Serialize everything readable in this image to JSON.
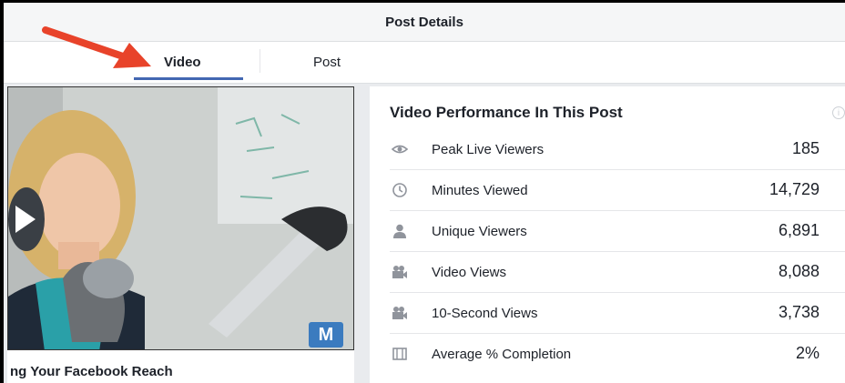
{
  "header": {
    "title": "Post Details"
  },
  "tabs": [
    {
      "label": "Video",
      "active": true
    },
    {
      "label": "Post",
      "active": false
    }
  ],
  "video": {
    "title": "ng Your Facebook Reach",
    "badge": "M",
    "play_icon": "play-icon"
  },
  "performance": {
    "title": "Video Performance In This Post",
    "metrics": [
      {
        "label": "Peak Live Viewers",
        "value": "185",
        "icon": "eye-icon"
      },
      {
        "label": "Minutes Viewed",
        "value": "14,729",
        "icon": "clock-icon"
      },
      {
        "label": "Unique Viewers",
        "value": "6,891",
        "icon": "person-icon"
      },
      {
        "label": "Video Views",
        "value": "8,088",
        "icon": "video-camera-icon"
      },
      {
        "label": "10-Second Views",
        "value": "3,738",
        "icon": "video-camera-icon"
      },
      {
        "label": "Average % Completion",
        "value": "2%",
        "icon": "film-icon"
      }
    ]
  },
  "colors": {
    "accent": "#4267b2",
    "arrow": "#e8432a",
    "badge": "#3b7bbf"
  }
}
